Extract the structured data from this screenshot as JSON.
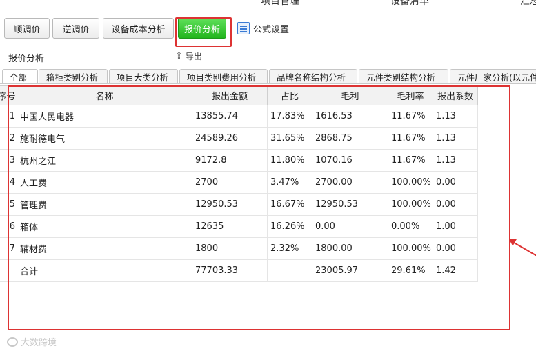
{
  "top_menu": [
    "项目管理",
    "设备清单",
    "汇总"
  ],
  "toolbar": {
    "buttons": [
      "顺调价",
      "逆调价",
      "设备成本分析",
      "报价分析"
    ],
    "active": "报价分析",
    "formula_label": "公式设置",
    "formula_icon": "formula-table-icon"
  },
  "subbar": {
    "title": "报价分析",
    "export_label": "导出",
    "export_icon": "export-icon"
  },
  "tabs": [
    "全部",
    "箱柜类别分析",
    "项目大类分析",
    "项目类别费用分析",
    "品牌名称结构分析",
    "元件类别结构分析",
    "元件厂家分析(以元件"
  ],
  "table": {
    "columns": [
      "序号",
      "名称",
      "报出金额",
      "占比",
      "毛利",
      "毛利率",
      "报出系数"
    ],
    "rows": [
      [
        "1",
        "中国人民电器",
        "13855.74",
        "17.83%",
        "1616.53",
        "11.67%",
        "1.13"
      ],
      [
        "2",
        "施耐德电气",
        "24589.26",
        "31.65%",
        "2868.75",
        "11.67%",
        "1.13"
      ],
      [
        "3",
        "杭州之江",
        "9172.8",
        "11.80%",
        "1070.16",
        "11.67%",
        "1.13"
      ],
      [
        "4",
        "人工费",
        "2700",
        "3.47%",
        "2700.00",
        "100.00%",
        "0.00"
      ],
      [
        "5",
        "管理费",
        "12950.53",
        "16.67%",
        "12950.53",
        "100.00%",
        "0.00"
      ],
      [
        "6",
        "箱体",
        "12635",
        "16.26%",
        "0.00",
        "0.00%",
        "1.00"
      ],
      [
        "7",
        "辅材费",
        "1800",
        "2.32%",
        "1800.00",
        "100.00%",
        "0.00"
      ],
      [
        "",
        "合计",
        "77703.33",
        "",
        "23005.97",
        "29.61%",
        "1.42"
      ]
    ]
  },
  "watermark": "大数跨境",
  "colors": {
    "active_button": "#22b51d",
    "annotation": "#d33333"
  }
}
